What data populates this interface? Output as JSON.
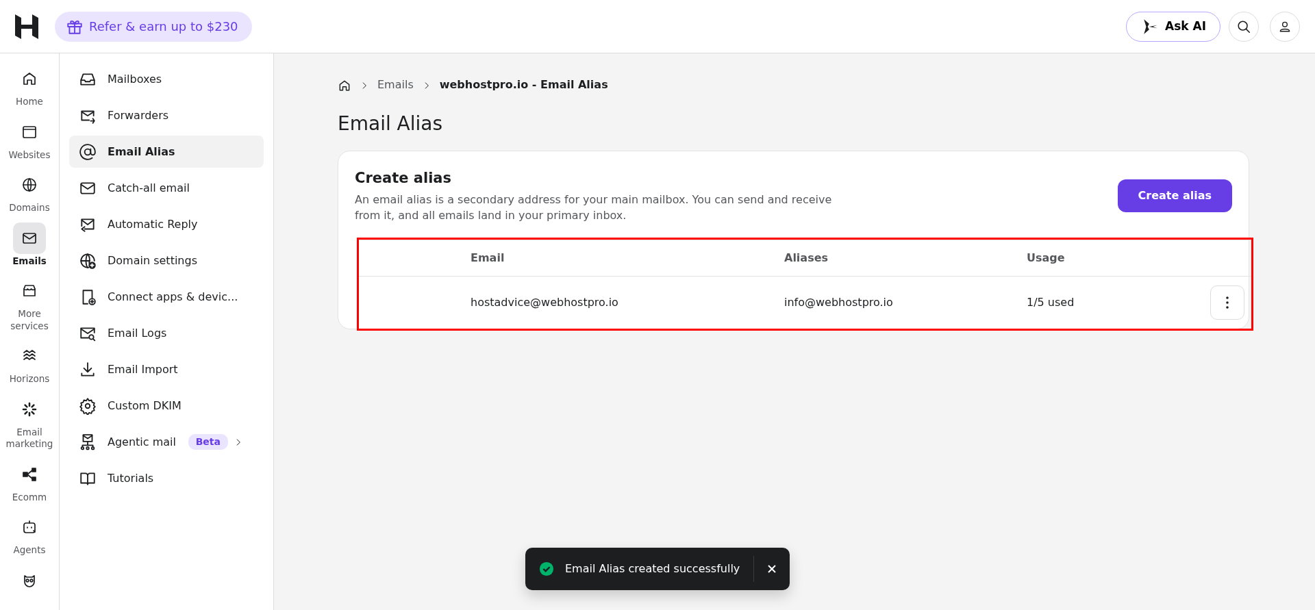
{
  "topbar": {
    "refer_button": "Refer & earn up to $230",
    "ask_ai_button": "Ask AI"
  },
  "rail": [
    {
      "label": "Home",
      "selected": false
    },
    {
      "label": "Websites",
      "selected": false
    },
    {
      "label": "Domains",
      "selected": false
    },
    {
      "label": "Emails",
      "selected": true
    },
    {
      "label": "More services",
      "selected": false
    },
    {
      "label": "Horizons",
      "selected": false
    },
    {
      "label": "Email marketing",
      "selected": false
    },
    {
      "label": "Ecomm",
      "selected": false
    },
    {
      "label": "Agents",
      "selected": false
    }
  ],
  "menu": [
    {
      "label": "Mailboxes",
      "selected": false
    },
    {
      "label": "Forwarders",
      "selected": false
    },
    {
      "label": "Email Alias",
      "selected": true
    },
    {
      "label": "Catch-all email",
      "selected": false
    },
    {
      "label": "Automatic Reply",
      "selected": false
    },
    {
      "label": "Domain settings",
      "selected": false
    },
    {
      "label": "Connect apps & devic...",
      "selected": false
    },
    {
      "label": "Email Logs",
      "selected": false
    },
    {
      "label": "Email Import",
      "selected": false
    },
    {
      "label": "Custom DKIM",
      "selected": false
    },
    {
      "label": "Agentic mail",
      "selected": false,
      "badge": "Beta"
    },
    {
      "label": "Tutorials",
      "selected": false
    }
  ],
  "breadcrumb": [
    "Emails",
    "webhostpro.io - Email Alias"
  ],
  "page_title": "Email Alias",
  "card": {
    "title": "Create alias",
    "description": "An email alias is a secondary address for your main mailbox. You can send and receive from it, and all emails land in your primary inbox.",
    "button": "Create alias"
  },
  "table": {
    "columns": [
      "Email",
      "Aliases",
      "Usage"
    ],
    "rows": [
      {
        "email": "hostadvice@webhostpro.io",
        "alias": "info@webhostpro.io",
        "usage": "1/5 used"
      }
    ]
  },
  "toast": {
    "message": "Email Alias created successfully"
  }
}
